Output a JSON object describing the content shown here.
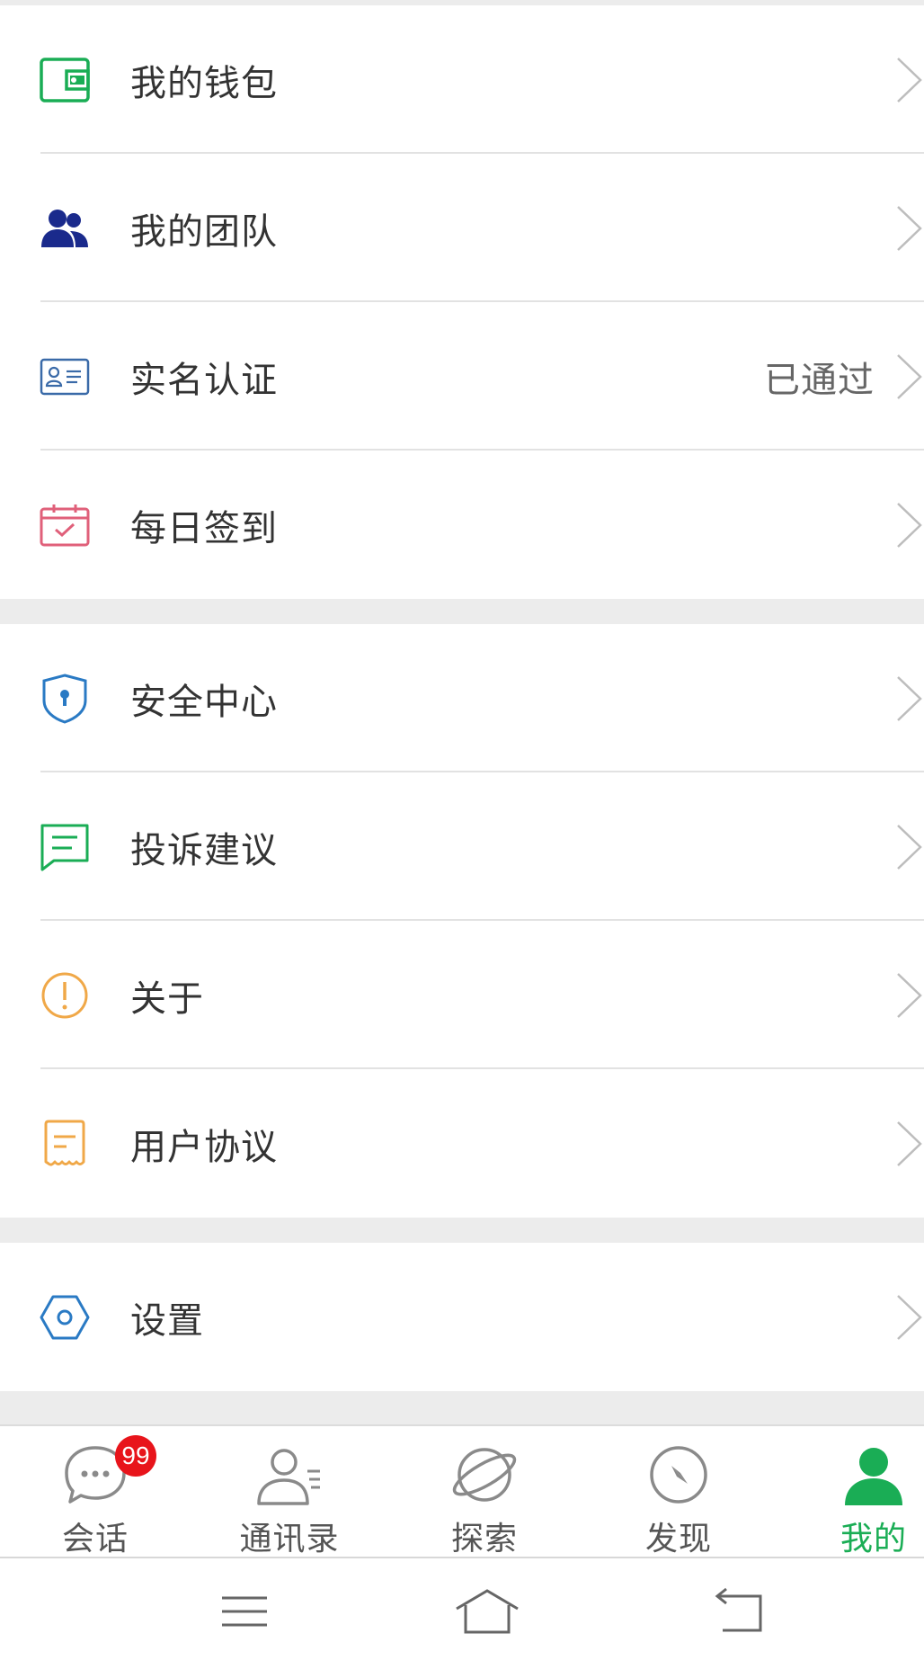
{
  "group1": [
    {
      "label": "我的钱包",
      "icon": "wallet-icon",
      "value": ""
    },
    {
      "label": "我的团队",
      "icon": "team-icon",
      "value": ""
    },
    {
      "label": "实名认证",
      "icon": "id-card-icon",
      "value": "已通过"
    },
    {
      "label": "每日签到",
      "icon": "calendar-check-icon",
      "value": ""
    }
  ],
  "group2": [
    {
      "label": "安全中心",
      "icon": "shield-icon",
      "value": ""
    },
    {
      "label": "投诉建议",
      "icon": "feedback-icon",
      "value": ""
    },
    {
      "label": "关于",
      "icon": "info-icon",
      "value": ""
    },
    {
      "label": "用户协议",
      "icon": "agreement-icon",
      "value": ""
    }
  ],
  "group3": [
    {
      "label": "设置",
      "icon": "settings-icon",
      "value": ""
    }
  ],
  "tabs": [
    {
      "label": "会话",
      "icon": "chat-icon",
      "badge": "99"
    },
    {
      "label": "通讯录",
      "icon": "contacts-icon"
    },
    {
      "label": "探索",
      "icon": "planet-icon"
    },
    {
      "label": "发现",
      "icon": "compass-icon"
    },
    {
      "label": "我的",
      "icon": "person-icon",
      "active": true
    }
  ],
  "colors": {
    "accent": "#1aad55",
    "badge": "#e8141b"
  }
}
